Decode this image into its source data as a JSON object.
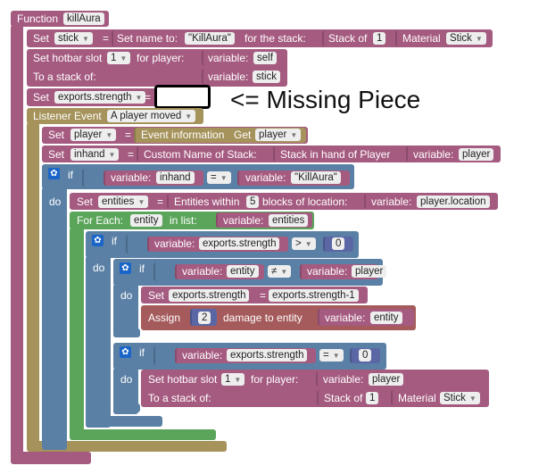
{
  "function": {
    "label": "Function",
    "name": "killAura"
  },
  "row_set_stick": {
    "set": "Set",
    "var": "stick",
    "eq": "=",
    "setname": "Set name to:",
    "name": "\"KillAura\"",
    "forstack": "for the stack:",
    "stackof": "Stack of",
    "count": "1",
    "material": "Material",
    "item": "Stick"
  },
  "row_hotbar1": {
    "text": "Set hotbar slot",
    "slot": "1",
    "forplayer": "for player:",
    "variable": "variable:",
    "value": "self",
    "tostack": "To a stack of:",
    "variable2": "variable:",
    "value2": "stick"
  },
  "row_exports": {
    "set": "Set",
    "var": "exports.strength",
    "eq": "="
  },
  "callout": "<= Missing Piece",
  "listener": {
    "label": "Listener Event",
    "event": "A player moved"
  },
  "row_player": {
    "set": "Set",
    "var": "player",
    "eq": "=",
    "info": "Event information",
    "get": "Get",
    "getval": "player"
  },
  "row_inhand": {
    "set": "Set",
    "var": "inhand",
    "eq": "=",
    "custom": "Custom Name of Stack:",
    "stackhand": "Stack in hand of Player",
    "variable": "variable:",
    "value": "player"
  },
  "if1": {
    "if": "if",
    "do": "do",
    "variable": "variable:",
    "value": "inhand",
    "op": "=",
    "variable2": "variable:",
    "value2": "\"KillAura\""
  },
  "row_entities": {
    "set": "Set",
    "var": "entities",
    "eq": "=",
    "within": "Entities within",
    "num": "5",
    "blocks": "blocks of location:",
    "variable": "variable:",
    "value": "player.location"
  },
  "foreach": {
    "label": "For Each:",
    "var": "entity",
    "inlist": "in list:",
    "variable": "variable:",
    "value": "entities"
  },
  "if2": {
    "if": "if",
    "do": "do",
    "variable": "variable:",
    "value": "exports.strength",
    "op": ">",
    "num": "0"
  },
  "if3": {
    "if": "if",
    "do": "do",
    "variable": "variable:",
    "value": "entity",
    "op": "≠",
    "variable2": "variable:",
    "value2": "player"
  },
  "row_dec": {
    "set": "Set",
    "var": "exports.strength",
    "eq": "=",
    "expr": "exports.strength-1"
  },
  "row_assign": {
    "assign": "Assign",
    "num": "2",
    "damage": "damage to entity",
    "variable": "variable:",
    "value": "entity"
  },
  "if4": {
    "if": "if",
    "do": "do",
    "variable": "variable:",
    "value": "exports.strength",
    "op": "=",
    "num": "0"
  },
  "row_hotbar2": {
    "text": "Set hotbar slot",
    "slot": "1",
    "forplayer": "for player:",
    "variable": "variable:",
    "value": "player",
    "tostack": "To a stack of:",
    "stackof": "Stack of",
    "count": "1",
    "material": "Material",
    "item": "Stick"
  }
}
